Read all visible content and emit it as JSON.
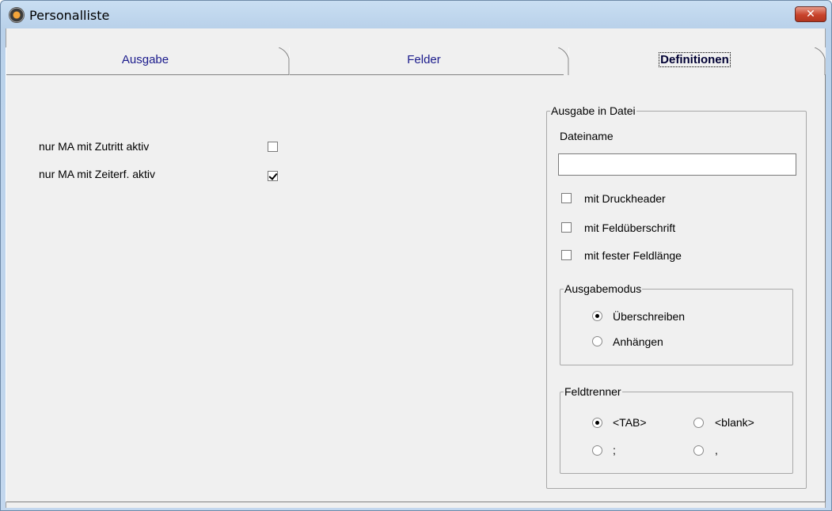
{
  "window": {
    "title": "Personalliste",
    "close_glyph": "✕"
  },
  "tabs": [
    {
      "label": "Ausgabe"
    },
    {
      "label": "Felder"
    },
    {
      "label": "Definitionen",
      "selected": true
    }
  ],
  "options": {
    "zutritt": {
      "label": "nur MA mit Zutritt aktiv",
      "checked": false
    },
    "zeiterf": {
      "label": "nur MA mit Zeiterf. aktiv",
      "checked": true
    }
  },
  "file_output": {
    "group_label": "Ausgabe in Datei",
    "filename_label": "Dateiname",
    "filename_value": "",
    "druckheader": {
      "label": "mit Druckheader",
      "checked": false
    },
    "feldueberschrift": {
      "label": "mit Feldüberschrift",
      "checked": false
    },
    "feste_feldlaenge": {
      "label": "mit fester Feldlänge",
      "checked": false
    },
    "mode": {
      "group_label": "Ausgabemodus",
      "overwrite": {
        "label": "Überschreiben",
        "selected": true
      },
      "append": {
        "label": "Anhängen",
        "selected": false
      }
    },
    "separator": {
      "group_label": "Feldtrenner",
      "tab": {
        "label": "<TAB>",
        "selected": true
      },
      "blank": {
        "label": "<blank>",
        "selected": false
      },
      "semicolon": {
        "label": ";",
        "selected": false
      },
      "comma": {
        "label": ",",
        "selected": false
      }
    }
  }
}
